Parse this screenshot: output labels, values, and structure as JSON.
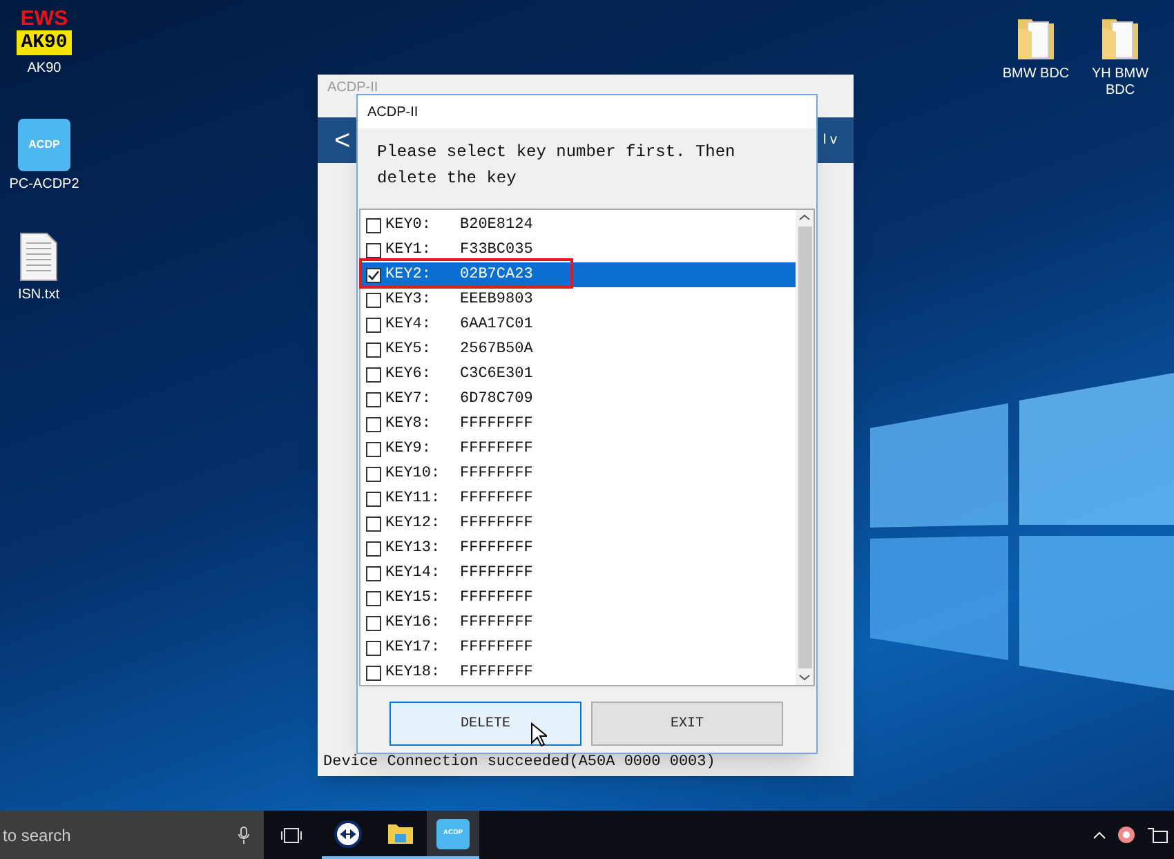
{
  "desktop_icons": [
    {
      "kind": "ews",
      "label": "AK90",
      "logo_top": "EWS",
      "logo_bottom": "AK90"
    },
    {
      "kind": "acdp",
      "label": "PC-ACDP2",
      "logo": "ACDP"
    },
    {
      "kind": "text",
      "label": "ISN.txt"
    },
    {
      "kind": "folder",
      "label": "BMW BDC"
    },
    {
      "kind": "folder",
      "label": "YH BMW BDC"
    }
  ],
  "back_window": {
    "title": "ACDP-II",
    "back_glyph": "<",
    "header_right": "l v",
    "status": "Device Connection succeeded(A50A 0000 0003)"
  },
  "dialog": {
    "title": "ACDP-II",
    "message": "Please select key number first. Then delete the key",
    "keys": [
      {
        "label": "KEY0:",
        "value": "B20E8124",
        "checked": false,
        "selected": false
      },
      {
        "label": "KEY1:",
        "value": "F33BC035",
        "checked": false,
        "selected": false
      },
      {
        "label": "KEY2:",
        "value": "02B7CA23",
        "checked": true,
        "selected": true
      },
      {
        "label": "KEY3:",
        "value": "EEEB9803",
        "checked": false,
        "selected": false
      },
      {
        "label": "KEY4:",
        "value": "6AA17C01",
        "checked": false,
        "selected": false
      },
      {
        "label": "KEY5:",
        "value": "2567B50A",
        "checked": false,
        "selected": false
      },
      {
        "label": "KEY6:",
        "value": "C3C6E301",
        "checked": false,
        "selected": false
      },
      {
        "label": "KEY7:",
        "value": "6D78C709",
        "checked": false,
        "selected": false
      },
      {
        "label": "KEY8:",
        "value": "FFFFFFFF",
        "checked": false,
        "selected": false
      },
      {
        "label": "KEY9:",
        "value": "FFFFFFFF",
        "checked": false,
        "selected": false
      },
      {
        "label": "KEY10:",
        "value": "FFFFFFFF",
        "checked": false,
        "selected": false
      },
      {
        "label": "KEY11:",
        "value": "FFFFFFFF",
        "checked": false,
        "selected": false
      },
      {
        "label": "KEY12:",
        "value": "FFFFFFFF",
        "checked": false,
        "selected": false
      },
      {
        "label": "KEY13:",
        "value": "FFFFFFFF",
        "checked": false,
        "selected": false
      },
      {
        "label": "KEY14:",
        "value": "FFFFFFFF",
        "checked": false,
        "selected": false
      },
      {
        "label": "KEY15:",
        "value": "FFFFFFFF",
        "checked": false,
        "selected": false
      },
      {
        "label": "KEY16:",
        "value": "FFFFFFFF",
        "checked": false,
        "selected": false
      },
      {
        "label": "KEY17:",
        "value": "FFFFFFFF",
        "checked": false,
        "selected": false
      },
      {
        "label": "KEY18:",
        "value": "FFFFFFFF",
        "checked": false,
        "selected": false
      }
    ],
    "buttons": [
      {
        "label": "DELETE",
        "focused": true
      },
      {
        "label": "EXIT",
        "focused": false
      }
    ]
  },
  "taskbar": {
    "search_placeholder": "to search",
    "apps": [
      {
        "kind": "remote",
        "active": false
      },
      {
        "kind": "folder",
        "active": false
      },
      {
        "kind": "acdp",
        "label": "ACDP",
        "active": true
      }
    ]
  }
}
